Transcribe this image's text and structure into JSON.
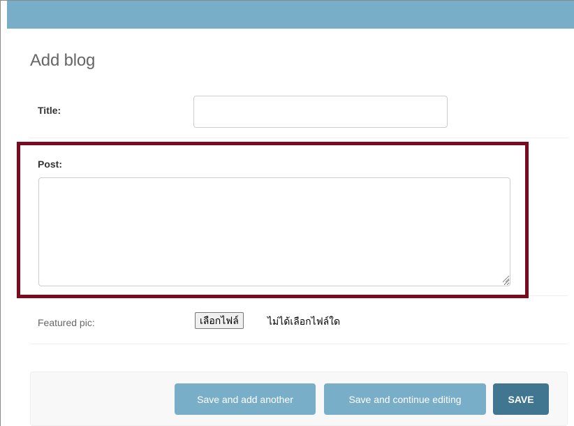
{
  "page": {
    "title": "Add blog"
  },
  "form": {
    "title_field": {
      "label": "Title:",
      "value": ""
    },
    "post_field": {
      "label": "Post:",
      "value": ""
    },
    "featured_pic_field": {
      "label": "Featured pic:",
      "button_label": "เลือกไฟล์",
      "status": "ไม่ได้เลือกไฟล์ใด"
    }
  },
  "submit_row": {
    "save_and_add_another": "Save and add another",
    "save_and_continue": "Save and continue editing",
    "save": "SAVE"
  },
  "colors": {
    "header": "#79aec8",
    "primary_button": "#79aec8",
    "default_button": "#417690",
    "highlight_border": "#7b0a1f"
  }
}
